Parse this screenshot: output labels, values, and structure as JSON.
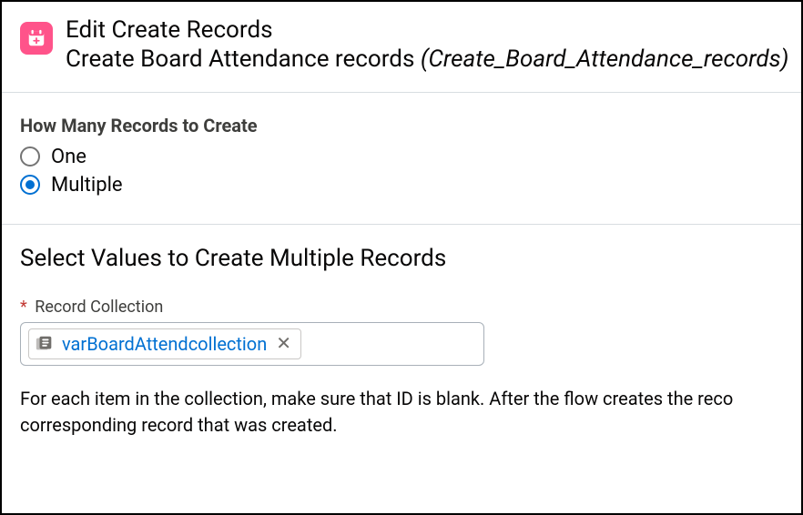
{
  "header": {
    "title": "Edit Create Records",
    "label": "Create Board Attendance records",
    "api_name": "(Create_Board_Attendance_records)"
  },
  "howMany": {
    "group_label": "How Many Records to Create",
    "options": {
      "one": "One",
      "multiple": "Multiple"
    },
    "selected": "multiple"
  },
  "values": {
    "heading": "Select Values to Create Multiple Records",
    "field_label": "Record Collection",
    "required_mark": "*",
    "pill_value": "varBoardAttendcollection",
    "help_line1": "For each item in the collection, make sure that ID is blank. After the flow creates the reco",
    "help_line2": "corresponding record that was created."
  },
  "icons": {
    "element": "create-records-icon",
    "collection": "record-collection-icon",
    "clear": "✕"
  }
}
